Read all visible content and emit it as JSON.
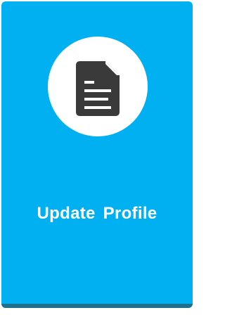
{
  "card": {
    "label": "Update Profile",
    "icon": "document-icon",
    "background_color": "#00b0f0",
    "accent_color": "#1f6f8f",
    "icon_color": "#3a3a3a"
  }
}
